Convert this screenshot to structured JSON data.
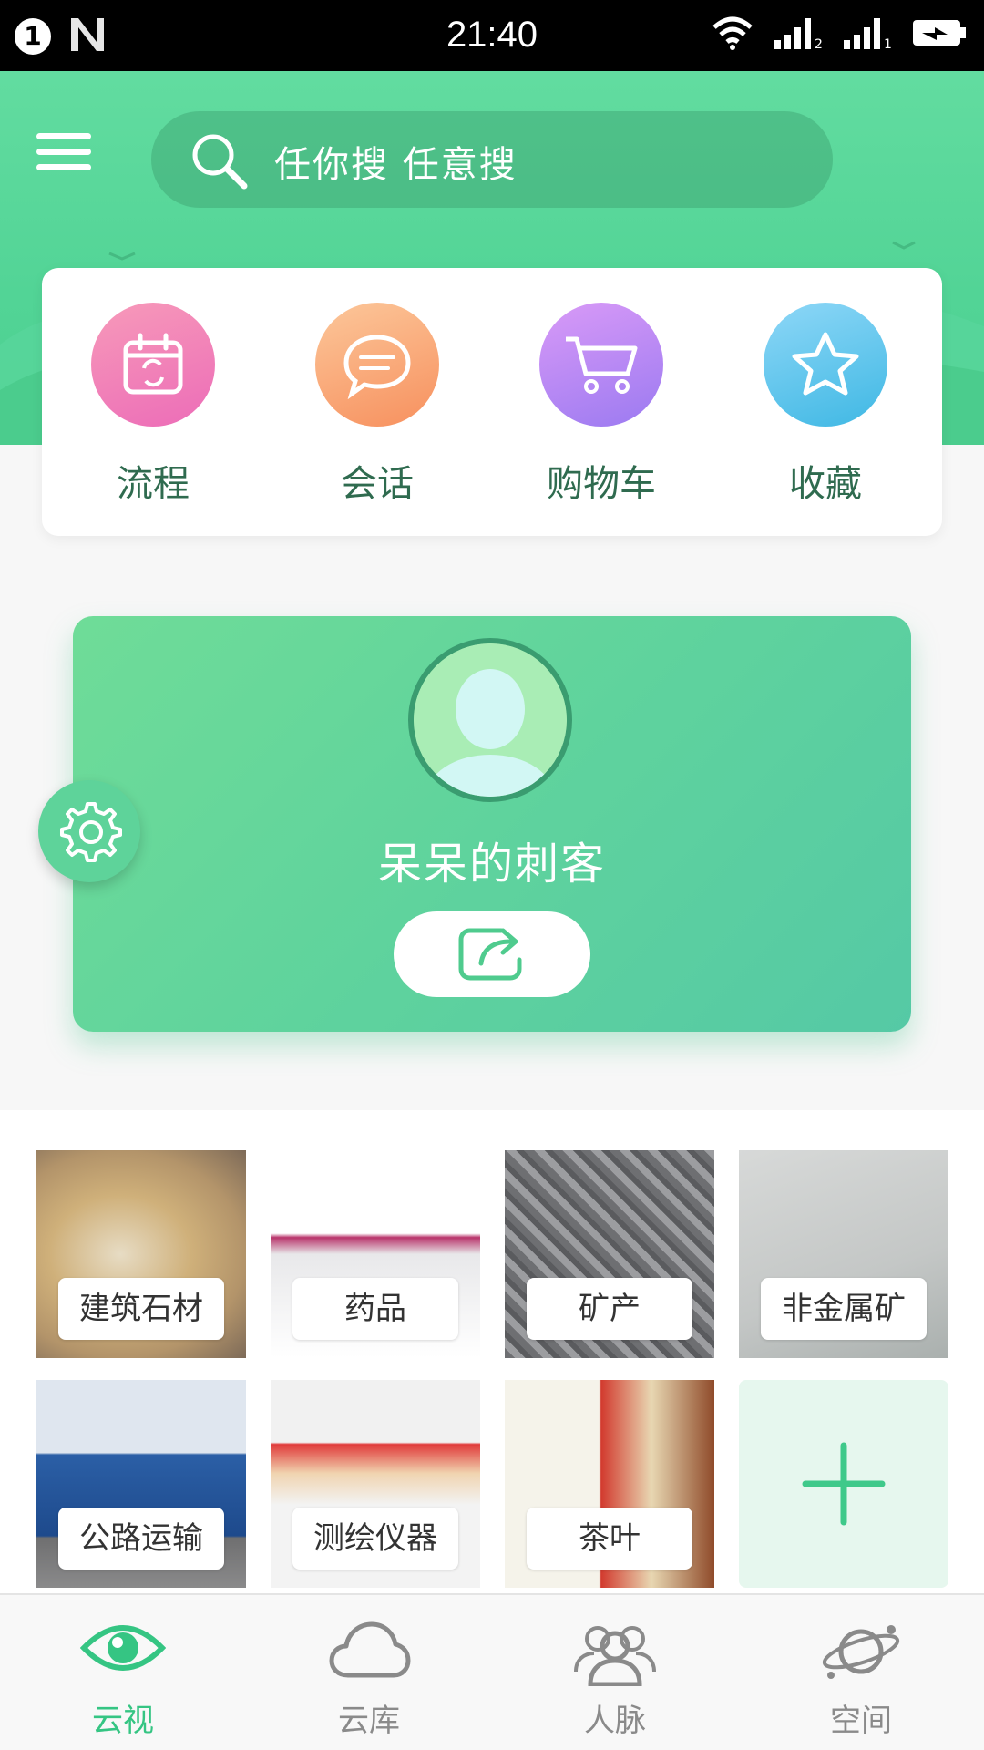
{
  "status_bar": {
    "notification_count": "1",
    "time": "21:40"
  },
  "search": {
    "placeholder": "任你搜   任意搜"
  },
  "quick_actions": [
    {
      "label": "流程",
      "icon": "calendar-icon"
    },
    {
      "label": "会话",
      "icon": "chat-icon"
    },
    {
      "label": "购物车",
      "icon": "cart-icon"
    },
    {
      "label": "收藏",
      "icon": "star-icon"
    }
  ],
  "profile": {
    "username": "呆呆的刺客"
  },
  "categories": [
    {
      "label": "建筑石材"
    },
    {
      "label": "药品"
    },
    {
      "label": "矿产"
    },
    {
      "label": "非金属矿"
    },
    {
      "label": "公路运输"
    },
    {
      "label": "测绘仪器"
    },
    {
      "label": "茶叶"
    }
  ],
  "bottom_nav": [
    {
      "label": "云视",
      "icon": "eye-icon",
      "active": true
    },
    {
      "label": "云库",
      "icon": "cloud-icon"
    },
    {
      "label": "人脉",
      "icon": "people-icon"
    },
    {
      "label": "空间",
      "icon": "planet-icon"
    }
  ],
  "colors": {
    "accent": "#35c583",
    "header": "#5ad99c",
    "text_green": "#2f6b4f"
  }
}
